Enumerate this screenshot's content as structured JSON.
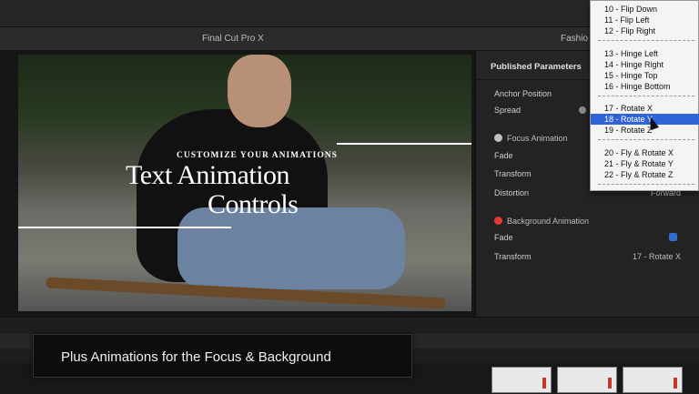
{
  "window": {
    "app_title": "Final Cut Pro X",
    "project_title": "Fashio"
  },
  "video": {
    "tagline": "CUSTOMIZE YOUR ANIMATIONS",
    "headline_line1": "Text Animation",
    "headline_line2": "Controls"
  },
  "inspector": {
    "header": "Published Parameters",
    "anchor_position": "Anchor Position",
    "spread": "Spread",
    "focus_animation": "Focus Animation",
    "focus_fade": "Fade",
    "focus_transform": "Transform",
    "focus_distortion": "Distortion",
    "focus_distortion_value": "Forward",
    "background_animation": "Background Animation",
    "bg_fade": "Fade",
    "bg_transform": "Transform",
    "bg_transform_value": "17 - Rotate X",
    "focus_icon_color": "#bfbfbf",
    "background_icon_color": "#e23a2e"
  },
  "dropdown": {
    "items": [
      "10 - Flip Down",
      "11 - Flip Left",
      "12 - Flip Right",
      "13 - Hinge Left",
      "14 - Hinge Right",
      "15 - Hinge Top",
      "16 - Hinge Bottom",
      "17 - Rotate X",
      "18 - Rotate Y",
      "19 - Rotate Z",
      "20 - Fly & Rotate X",
      "21 - Fly & Rotate Y",
      "22 - Fly & Rotate Z"
    ],
    "selected_color": "#2f63d6"
  },
  "caption": {
    "text": "Plus Animations for the Focus & Background"
  }
}
